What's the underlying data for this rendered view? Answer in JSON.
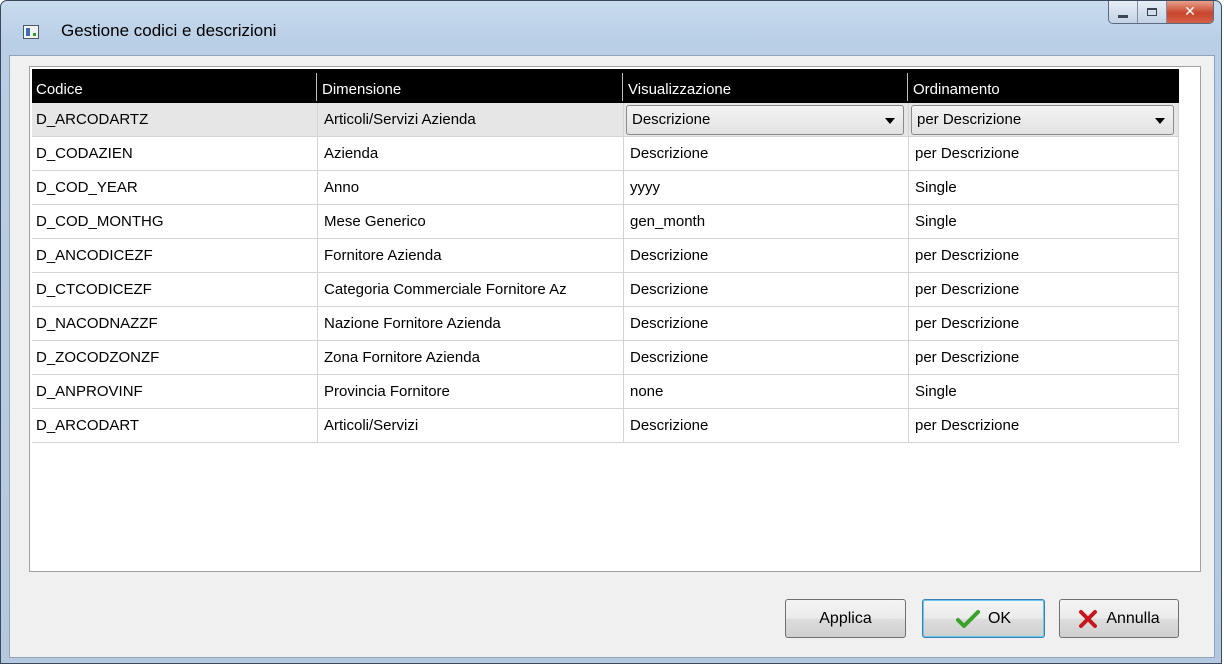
{
  "window": {
    "title": "Gestione codici e descrizioni",
    "controls": {
      "minimize": "minimize",
      "maximize": "maximize",
      "close": "x"
    }
  },
  "table": {
    "columns": [
      "Codice",
      "Dimensione",
      "Visualizzazione",
      "Ordinamento"
    ],
    "rows": [
      {
        "codice": "D_ARCODARTZ",
        "dimensione": "Articoli/Servizi Azienda",
        "visualizzazione": "Descrizione",
        "ordinamento": "per Descrizione"
      },
      {
        "codice": "D_CODAZIEN",
        "dimensione": "Azienda",
        "visualizzazione": "Descrizione",
        "ordinamento": "per Descrizione"
      },
      {
        "codice": "D_COD_YEAR",
        "dimensione": "Anno",
        "visualizzazione": "yyyy",
        "ordinamento": "Single"
      },
      {
        "codice": "D_COD_MONTHG",
        "dimensione": "Mese Generico",
        "visualizzazione": "gen_month",
        "ordinamento": "Single"
      },
      {
        "codice": "D_ANCODICEZF",
        "dimensione": "Fornitore Azienda",
        "visualizzazione": "Descrizione",
        "ordinamento": "per Descrizione"
      },
      {
        "codice": "D_CTCODICEZF",
        "dimensione": "Categoria Commerciale Fornitore Az",
        "visualizzazione": "Descrizione",
        "ordinamento": "per Descrizione"
      },
      {
        "codice": "D_NACODNAZZF",
        "dimensione": "Nazione Fornitore Azienda",
        "visualizzazione": "Descrizione",
        "ordinamento": "per Descrizione"
      },
      {
        "codice": "D_ZOCODZONZF",
        "dimensione": "Zona Fornitore Azienda",
        "visualizzazione": "Descrizione",
        "ordinamento": "per Descrizione"
      },
      {
        "codice": "D_ANPROVINF",
        "dimensione": "Provincia Fornitore",
        "visualizzazione": "none",
        "ordinamento": "Single"
      },
      {
        "codice": "D_ARCODART",
        "dimensione": "Articoli/Servizi",
        "visualizzazione": "Descrizione",
        "ordinamento": "per Descrizione"
      }
    ],
    "selected_row": 0
  },
  "buttons": {
    "apply": "Applica",
    "ok": "OK",
    "cancel": "Annulla"
  },
  "icons": {
    "ok": "checkmark-icon",
    "cancel": "x-mark-icon"
  },
  "colors": {
    "header_bg": "#000000",
    "ok_check": "#3aa12a",
    "cancel_x": "#c8161d"
  }
}
